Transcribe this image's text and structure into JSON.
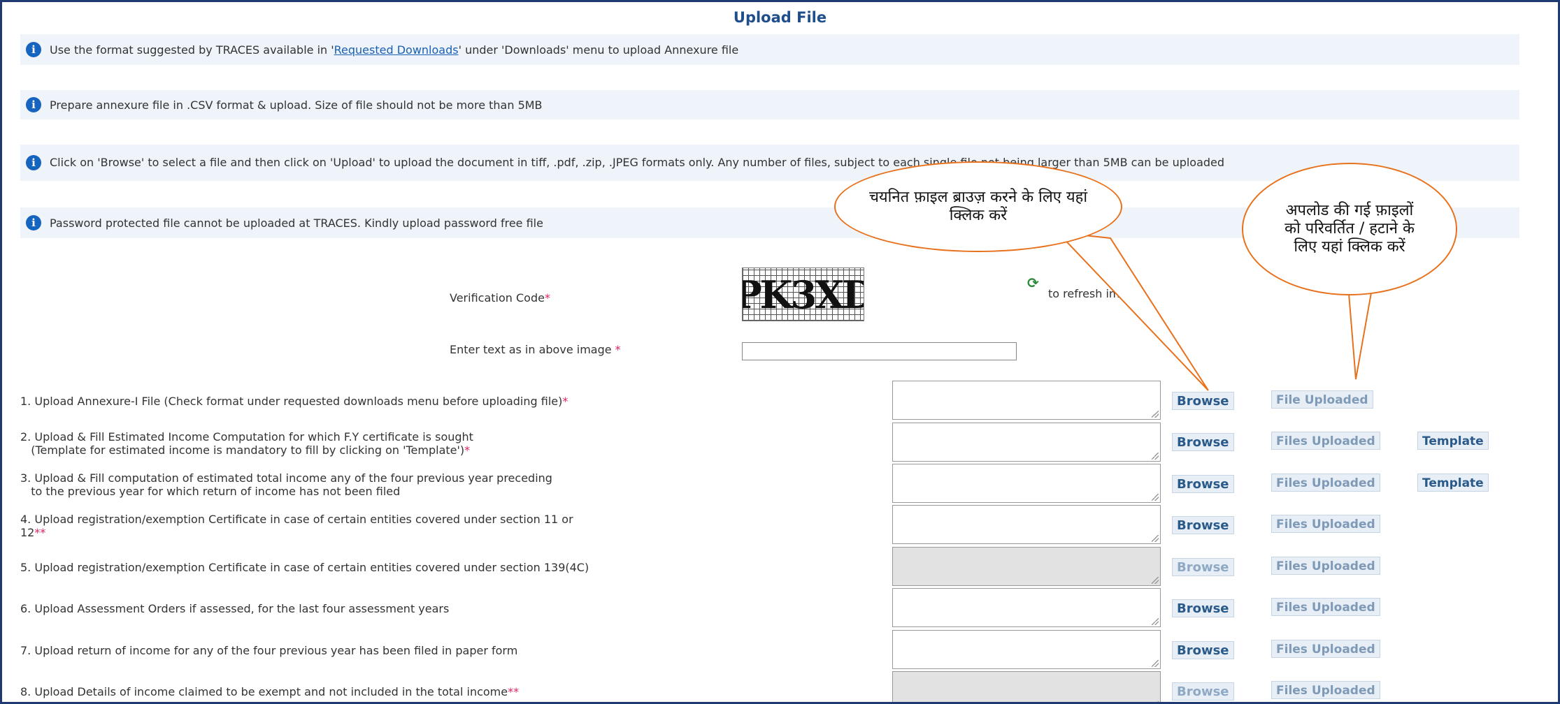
{
  "title": "Upload File",
  "info": [
    {
      "pre": "Use the format suggested by TRACES available in '",
      "link": "Requested Downloads",
      "post": "' under 'Downloads' menu to upload Annexure file"
    },
    {
      "pre": "Prepare annexure file in .CSV format & upload. Size of file should not be more than 5MB",
      "link": "",
      "post": ""
    },
    {
      "pre": "Click on 'Browse' to select a file and then click on 'Upload' to upload the document in tiff, .pdf, .zip, .JPEG formats only. Any number of files, subject to each single file not being larger than 5MB can be uploaded",
      "link": "",
      "post": ""
    },
    {
      "pre": "Password protected file cannot be uploaded at TRACES. Kindly upload password free file",
      "link": "",
      "post": ""
    }
  ],
  "verification": {
    "label": "Verification Code",
    "required_mark": "*",
    "captcha_text": "PK3XD",
    "refresh_text": "to refresh image",
    "enter_label": "Enter text as in above image",
    "enter_required_mark": "*",
    "enter_value": ""
  },
  "rows": [
    {
      "text": "1. Upload Annexure-I File (Check format under requested downloads menu before uploading file)",
      "mark": "*",
      "browse": "Browse",
      "uploaded": "File Uploaded",
      "template": ""
    },
    {
      "text": "2. Upload & Fill Estimated Income Computation for which F.Y certificate is sought\n   (Template for estimated income is mandatory to fill by clicking on 'Template')",
      "mark": "*",
      "browse": "Browse",
      "uploaded": "Files Uploaded",
      "template": "Template"
    },
    {
      "text": "3. Upload & Fill computation of estimated total income any of the four previous year preceding\n   to the previous year for which return of income has not been filed",
      "mark": "",
      "browse": "Browse",
      "uploaded": "Files Uploaded",
      "template": "Template"
    },
    {
      "text": "4. Upload registration/exemption Certificate in case of certain entities covered under section 11 or\n12",
      "mark": "**",
      "browse": "Browse",
      "uploaded": "Files Uploaded",
      "template": ""
    },
    {
      "text": "5. Upload registration/exemption Certificate in case of certain entities covered under section 139(4C)",
      "mark": "",
      "browse": "Browse",
      "uploaded": "Files Uploaded",
      "template": ""
    },
    {
      "text": "6. Upload Assessment Orders if assessed, for the last four assessment years",
      "mark": "",
      "browse": "Browse",
      "uploaded": "Files Uploaded",
      "template": ""
    },
    {
      "text": "7. Upload return of income for any of the four previous year has been filed in paper form",
      "mark": "",
      "browse": "Browse",
      "uploaded": "Files Uploaded",
      "template": ""
    },
    {
      "text": "8. Upload Details of income claimed to be exempt and not included in the total income",
      "mark": "**",
      "browse": "Browse",
      "uploaded": "Files Uploaded",
      "template": ""
    }
  ],
  "callouts": {
    "browse": "चयनित फ़ाइल ब्राउज़ करने के लिए यहां क्लिक करें",
    "uploaded": "अपलोड की गई फ़ाइलों को परिवर्तित / हटाने के लिए यहां क्लिक करें"
  },
  "colors": {
    "accent": "#1f4e8c",
    "callout_border": "#e8711c",
    "required": "#e0245e"
  }
}
